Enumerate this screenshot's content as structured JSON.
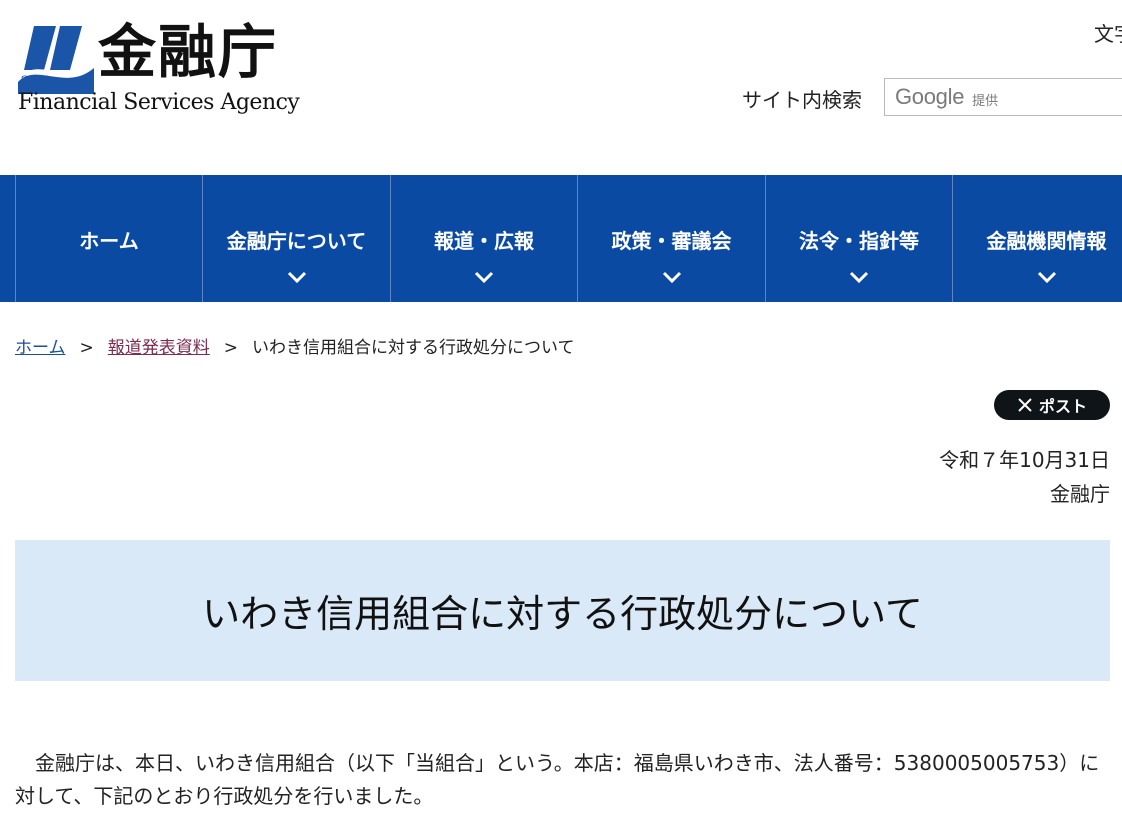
{
  "header": {
    "logo_title": "金融庁",
    "logo_subtitle": "Financial Services Agency",
    "logo_badge": "25th",
    "fontsize_label": "文字",
    "search_label": "サイト内検索",
    "search_brand": "Google",
    "search_provided": "提供"
  },
  "nav": {
    "items": [
      {
        "label": "ホーム"
      },
      {
        "label": "金融庁について"
      },
      {
        "label": "報道・広報"
      },
      {
        "label": "政策・審議会"
      },
      {
        "label": "法令・指針等"
      },
      {
        "label": "金融機関情報"
      }
    ]
  },
  "breadcrumb": {
    "home": "ホーム",
    "sep": ">",
    "parent": "報道発表資料",
    "current": "いわき信用組合に対する行政処分について"
  },
  "share": {
    "post_label": "ポスト"
  },
  "meta": {
    "date": "令和７年10月31日",
    "issuer": "金融庁"
  },
  "article": {
    "title": "いわき信用組合に対する行政処分について",
    "body": "　金融庁は、本日、いわき信用組合（以下「当組合」という。本店：福島県いわき市、法人番号：5380005005753）に対して、下記のとおり行政処分を行いました。"
  },
  "colors": {
    "nav_bg": "#0b4aa2",
    "title_band_bg": "#d9e9f7",
    "link": "#1d4f97",
    "visited_link": "#7b2d52"
  }
}
